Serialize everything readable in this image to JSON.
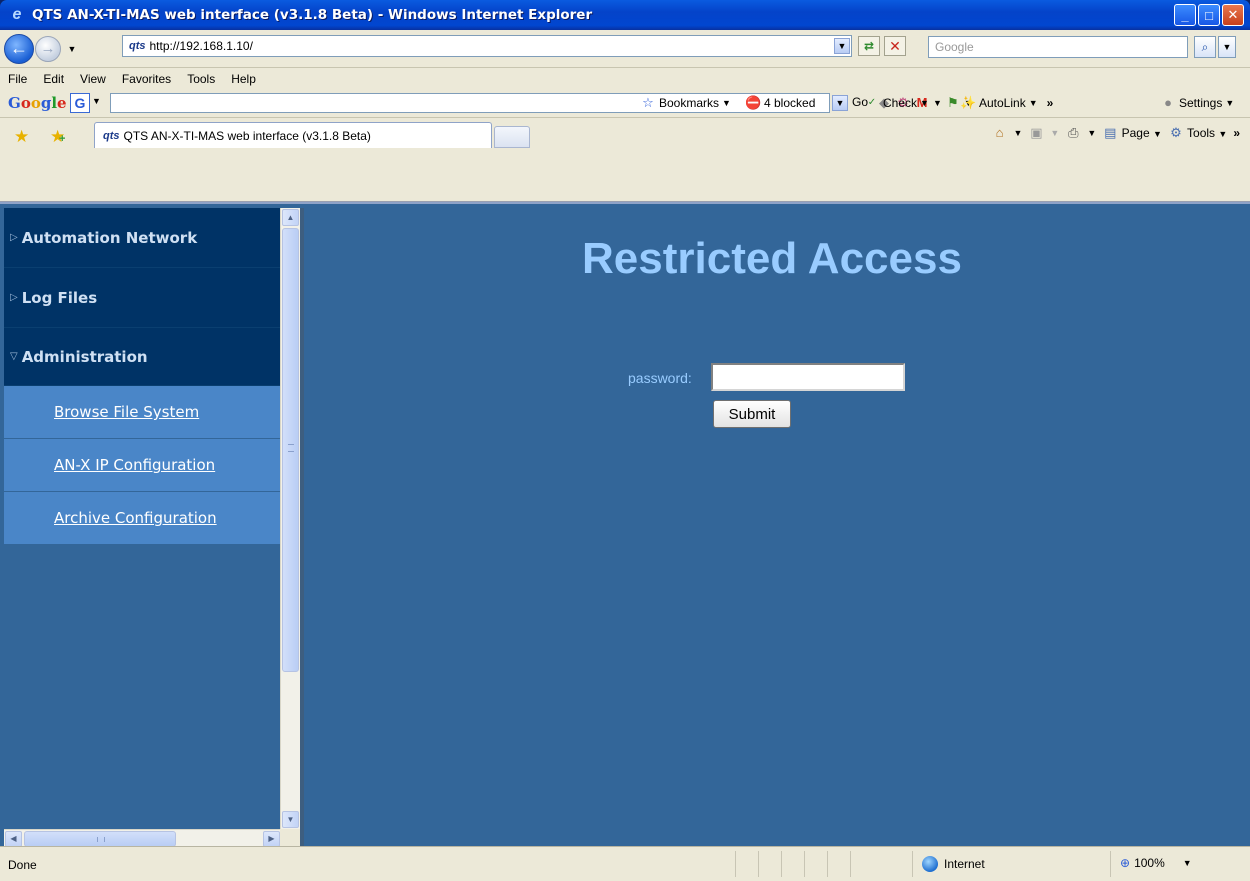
{
  "window": {
    "title": "QTS AN-X-TI-MAS web interface (v3.1.8 Beta) - Windows Internet Explorer",
    "minimize": "_",
    "maximize": "□",
    "close": "✕"
  },
  "address_bar": {
    "url": "http://192.168.1.10/",
    "favicon_text": "qts"
  },
  "search_box": {
    "placeholder": "Google"
  },
  "menu": {
    "file": "File",
    "edit": "Edit",
    "view": "View",
    "favorites": "Favorites",
    "tools": "Tools",
    "help": "Help"
  },
  "google_toolbar": {
    "go_label": "Go",
    "bookmarks_label": "Bookmarks",
    "blocked_label": "4 blocked",
    "check_label": "Check",
    "autolink_label": "AutoLink",
    "settings_label": "Settings"
  },
  "tabs": {
    "active_title": "QTS AN-X-TI-MAS web interface (v3.1.8 Beta)",
    "favicon_text": "qts"
  },
  "command_bar": {
    "page_label": "Page",
    "tools_label": "Tools"
  },
  "sidebar": {
    "sections": [
      {
        "label": "Automation Network",
        "expanded": false
      },
      {
        "label": "Log Files",
        "expanded": false
      },
      {
        "label": "Administration",
        "expanded": true
      }
    ],
    "admin_items": [
      {
        "label": "Browse File System"
      },
      {
        "label": "AN-X IP Configuration"
      },
      {
        "label": "Archive Configuration"
      }
    ]
  },
  "main": {
    "heading": "Restricted Access",
    "password_label": "password:",
    "password_value": "",
    "submit_label": "Submit"
  },
  "status_bar": {
    "status": "Done",
    "zone": "Internet",
    "zoom": "100%"
  },
  "colors": {
    "content_bg": "#336699",
    "nav_section_bg": "#003366",
    "nav_sub_bg": "#4a86c8",
    "heading_color": "#99ccff"
  }
}
